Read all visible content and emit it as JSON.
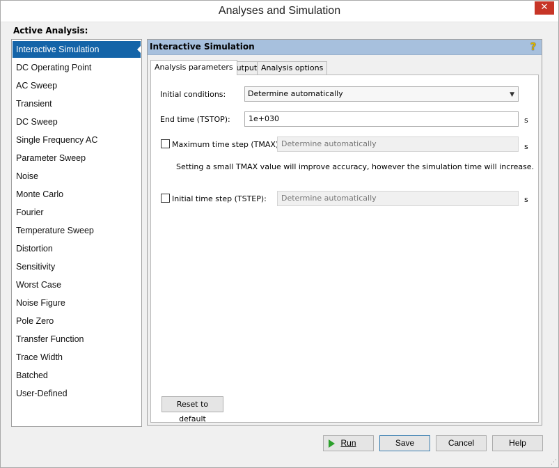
{
  "window": {
    "title": "Analyses and Simulation",
    "close_glyph": "✕"
  },
  "active_analysis_label": "Active Analysis:",
  "analyses": [
    "Interactive Simulation",
    "DC Operating Point",
    "AC Sweep",
    "Transient",
    "DC Sweep",
    "Single Frequency AC",
    "Parameter Sweep",
    "Noise",
    "Monte Carlo",
    "Fourier",
    "Temperature Sweep",
    "Distortion",
    "Sensitivity",
    "Worst Case",
    "Noise Figure",
    "Pole Zero",
    "Transfer Function",
    "Trace Width",
    "Batched",
    "User-Defined"
  ],
  "selected_analysis": "Interactive Simulation",
  "panel": {
    "title": "Interactive Simulation",
    "help_glyph": "?",
    "tabs": [
      "Analysis parameters",
      "Output",
      "Analysis options"
    ],
    "active_tab": "Analysis parameters"
  },
  "form": {
    "initial_conditions_label": "Initial conditions:",
    "initial_conditions_value": "Determine automatically",
    "end_time_label": "End time (TSTOP):",
    "end_time_value": "1e+030",
    "end_time_unit": "s",
    "tmax_label": "Maximum time step (TMAX):",
    "tmax_checked": false,
    "tmax_value": "Determine automatically",
    "tmax_unit": "s",
    "tmax_hint": "Setting a small TMAX value will improve accuracy, however the simulation time will increase.",
    "tstep_label": "Initial time step (TSTEP):",
    "tstep_checked": false,
    "tstep_value": "Determine automatically",
    "tstep_unit": "s",
    "reset_label": "Reset to default"
  },
  "buttons": {
    "run": "Run",
    "save": "Save",
    "cancel": "Cancel",
    "help": "Help"
  },
  "colors": {
    "selection": "#1464a8",
    "panel_header": "#a7c0dd",
    "close_button": "#c73527",
    "run_icon": "#2ca02c"
  }
}
